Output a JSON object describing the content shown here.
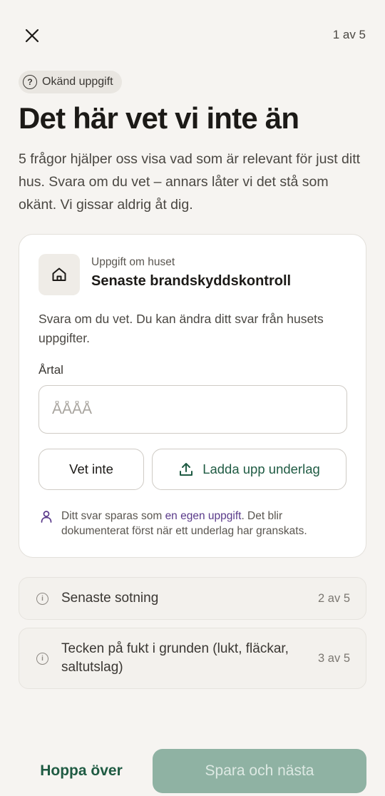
{
  "header": {
    "close_icon": "close-icon",
    "step": "1 av 5"
  },
  "tag": {
    "icon": "question-circle-icon",
    "label": "Okänd uppgift"
  },
  "title": "Det här vet vi inte än",
  "intro": "5 frågor hjälper oss visa vad som är relevant för just ditt hus. Svara om du vet – annars låter vi det stå som okänt. Vi gissar aldrig åt dig.",
  "card": {
    "icon": "house-icon",
    "kicker": "Uppgift om huset",
    "title": "Senaste brandskyddskontroll",
    "description": "Svara om du vet. Du kan ändra ditt svar från husets uppgifter.",
    "field_label": "Årtal",
    "input_value": "",
    "input_placeholder": "ÅÅÅÅ",
    "unknown_button": "Vet inte",
    "upload_button": "Ladda upp underlag",
    "upload_icon": "upload-icon",
    "note_icon": "person-icon",
    "note_before": "Ditt svar sparas som ",
    "note_link": "en egen uppgift",
    "note_after": ". Det blir dokumenterat först när ett underlag har granskats."
  },
  "questions": [
    {
      "icon": "info-icon",
      "label": "Senaste sotning",
      "count": "2 av 5"
    },
    {
      "icon": "info-icon",
      "label": "Tecken på fukt i grunden (lukt, fläckar, saltutslag)",
      "count": "3 av 5"
    }
  ],
  "footer": {
    "skip": "Hoppa över",
    "save": "Spara och nästa"
  },
  "colors": {
    "background": "#f6f4f1",
    "accent_green": "#1f5b43",
    "save_disabled": "#8fb2a3",
    "link_purple": "#5a3a8a"
  }
}
